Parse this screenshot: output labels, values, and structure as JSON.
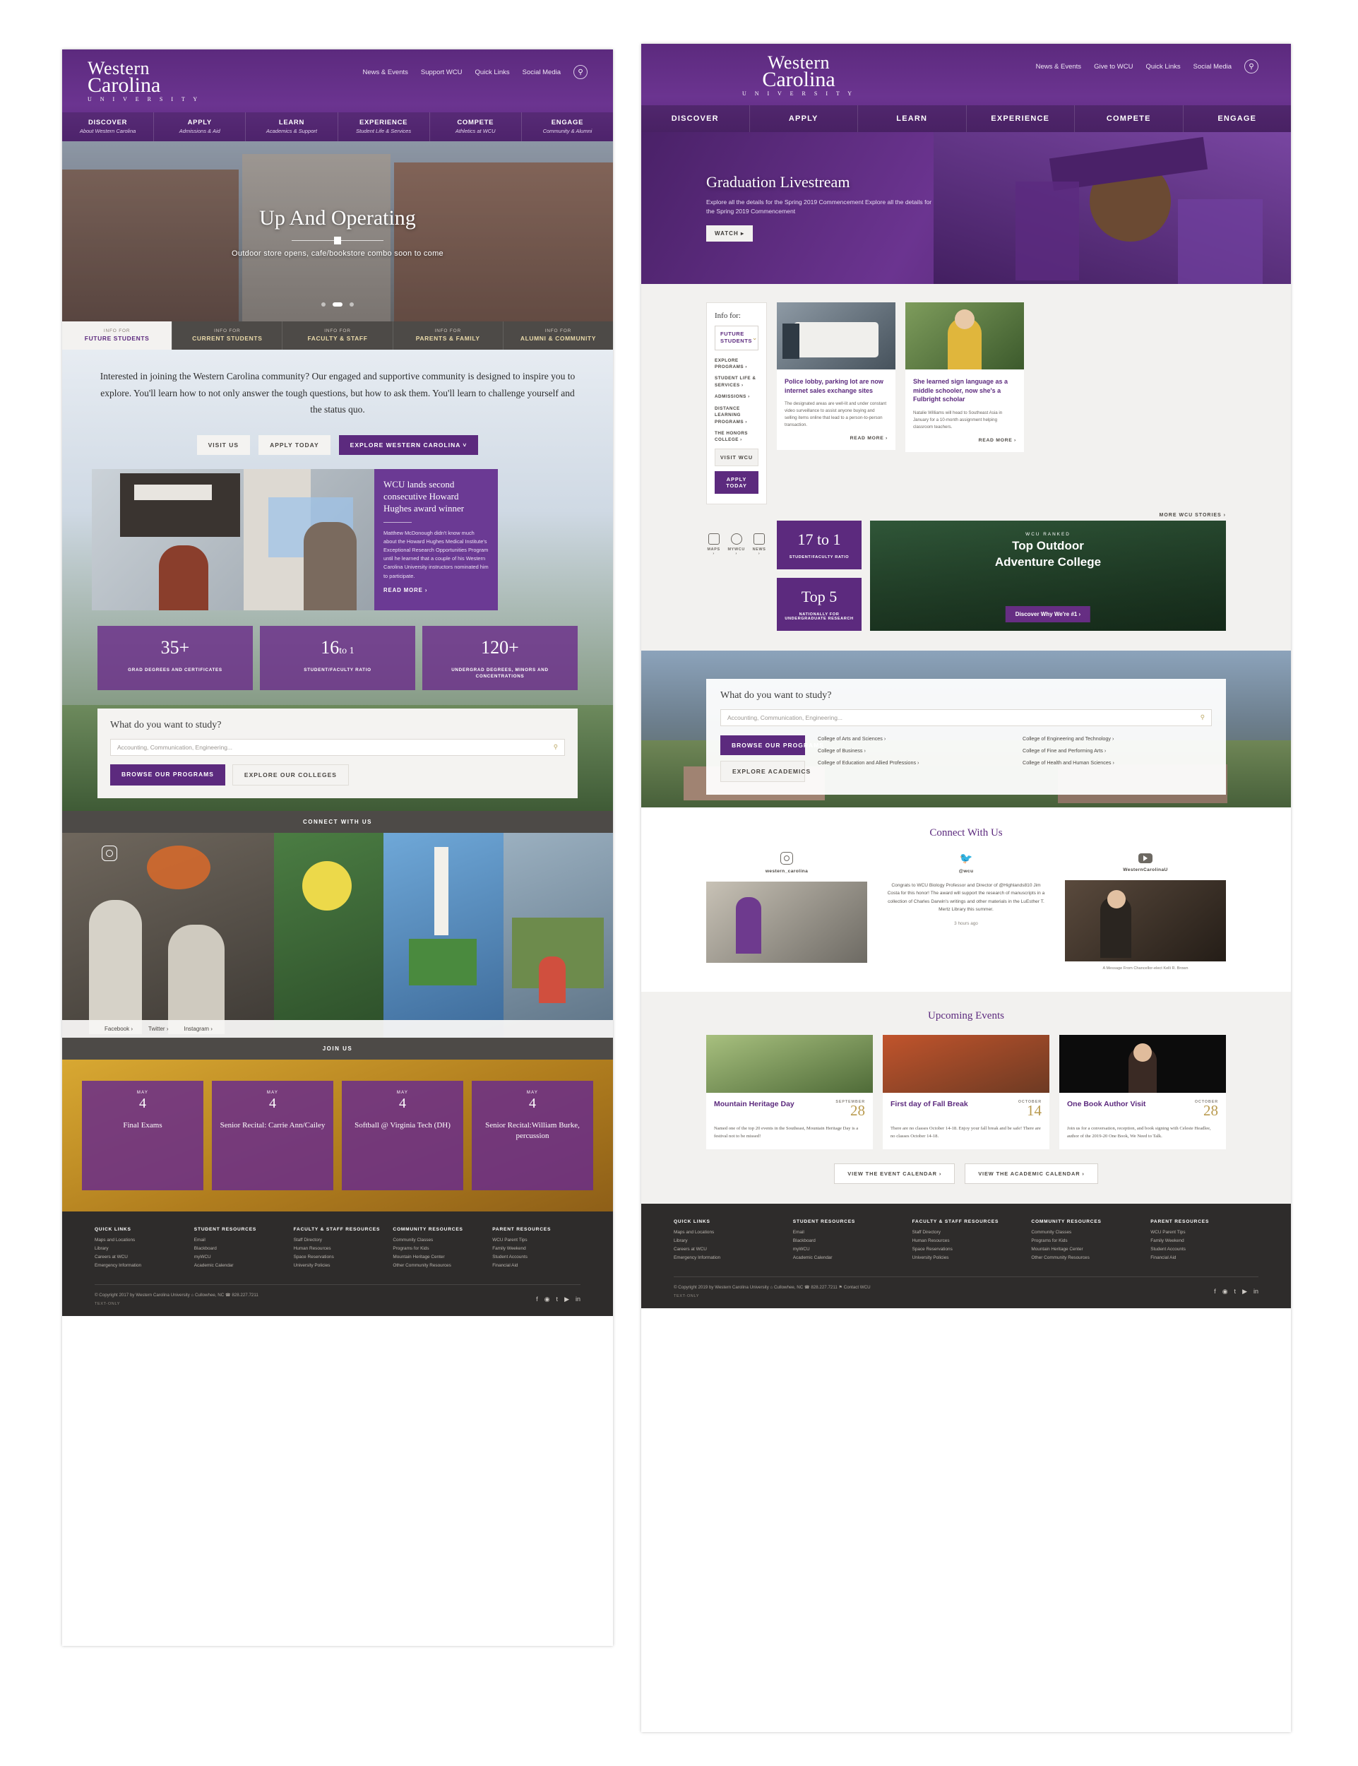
{
  "brand": {
    "line1": "Western",
    "line2": "Carolina",
    "line3": "U N I V E R S I T Y",
    "purple": "#5c2a7e",
    "gold": "#b99a4e",
    "dark": "#2e2c2b"
  },
  "top_links": [
    "News & Events",
    "Support WCU",
    "Quick Links",
    "Social Media"
  ],
  "top_links_b": [
    "News & Events",
    "Give to WCU",
    "Quick Links",
    "Social Media"
  ],
  "main_nav": [
    {
      "title": "DISCOVER",
      "sub": "About Western Carolina"
    },
    {
      "title": "APPLY",
      "sub": "Admissions & Aid"
    },
    {
      "title": "LEARN",
      "sub": "Academics & Support"
    },
    {
      "title": "EXPERIENCE",
      "sub": "Student Life & Services"
    },
    {
      "title": "COMPETE",
      "sub": "Athletics at WCU"
    },
    {
      "title": "ENGAGE",
      "sub": "Community & Alumni"
    }
  ],
  "main_nav_b": [
    "DISCOVER",
    "APPLY",
    "LEARN",
    "EXPERIENCE",
    "COMPETE",
    "ENGAGE"
  ],
  "heroA": {
    "title": "Up And Operating",
    "subtitle": "Outdoor store opens, cafe/bookstore combo soon to come"
  },
  "info_tabs": [
    {
      "kicker": "INFO FOR",
      "label": "FUTURE STUDENTS"
    },
    {
      "kicker": "INFO FOR",
      "label": "CURRENT STUDENTS"
    },
    {
      "kicker": "INFO FOR",
      "label": "FACULTY & STAFF"
    },
    {
      "kicker": "INFO FOR",
      "label": "PARENTS & FAMILY"
    },
    {
      "kicker": "INFO FOR",
      "label": "ALUMNI & COMMUNITY"
    }
  ],
  "intro": {
    "paragraph": "Interested in joining the Western Carolina community? Our engaged and supportive community is designed to inspire you to explore. You'll learn how to not only answer the tough questions, but how to ask them. You'll learn to challenge yourself and the status quo.",
    "buttons": [
      "VISIT US",
      "APPLY TODAY",
      "EXPLORE WESTERN CAROLINA  ˅"
    ]
  },
  "feature_card": {
    "title": "WCU lands second consecutive Howard Hughes award winner",
    "body": "Matthew McDonough didn't know much about the Howard Hughes Medical Institute's Exceptional Research Opportunities Program until he learned that a couple of his Western Carolina University instructors nominated him to participate.",
    "read_more": "READ MORE  ›"
  },
  "stats": [
    {
      "num": "35+",
      "sub": "",
      "label": "GRAD DEGREES AND CERTIFICATES"
    },
    {
      "num": "16",
      "sub": "to 1",
      "label": "STUDENT/FACULTY RATIO"
    },
    {
      "num": "120+",
      "sub": "",
      "label": "UNDERGRAD DEGREES, MINORS AND CONCENTRATIONS"
    }
  ],
  "study": {
    "heading": "What do you want to study?",
    "placeholder": "Accounting, Communication, Engineering...",
    "btn1": "BROWSE OUR PROGRAMS",
    "btn2": "EXPLORE OUR COLLEGES",
    "btn2b": "EXPLORE ACADEMICS"
  },
  "connect_strip": "CONNECT WITH US",
  "join_strip": "JOIN US",
  "social_row": [
    "Facebook  ›",
    "Twitter  ›",
    "Instagram  ›"
  ],
  "events_left": [
    {
      "month": "MAY",
      "day": "4",
      "title": "Final Exams"
    },
    {
      "month": "MAY",
      "day": "4",
      "title": "Senior Recital: Carrie Ann/Cailey"
    },
    {
      "month": "MAY",
      "day": "4",
      "title": "Softball @ Virginia Tech (DH)"
    },
    {
      "month": "MAY",
      "day": "4",
      "title": "Senior Recital:William Burke, percussion"
    }
  ],
  "footer": {
    "columns": [
      {
        "head": "QUICK LINKS",
        "links": [
          "Maps and Locations",
          "Library",
          "Careers at WCU",
          "Emergency Information"
        ]
      },
      {
        "head": "STUDENT RESOURCES",
        "links": [
          "Email",
          "Blackboard",
          "myWCU",
          "Academic Calendar"
        ]
      },
      {
        "head": "FACULTY & STAFF RESOURCES",
        "links": [
          "Staff Directory",
          "Human Resources",
          "Space Reservations",
          "University Policies"
        ]
      },
      {
        "head": "COMMUNITY RESOURCES",
        "links": [
          "Community Classes",
          "Programs for Kids",
          "Mountain Heritage Center",
          "Other Community Resources"
        ]
      },
      {
        "head": "PARENT RESOURCES",
        "links": [
          "WCU Parent Tips",
          "Family Weekend",
          "Student Accounts",
          "Financial Aid"
        ]
      }
    ],
    "copyright_a": "© Copyright 2017 by Western Carolina University   ⌂ Cullowhee, NC   ☎ 828.227.7211",
    "copyright_b": "© Copyright 2019 by Western Carolina University   ⌂ Cullowhee, NC   ☎ 828.227.7211   ⚑ Contact WCU",
    "text_only": "TEXT-ONLY",
    "social_icons_a": [
      "f",
      "◉",
      "t",
      "▶",
      "in"
    ],
    "social_icons_b": [
      "f",
      "◉",
      "t",
      "▶",
      "in"
    ]
  },
  "heroB": {
    "title": "Graduation Livestream",
    "body": "Explore all the details for the Spring 2019 Commencement Explore all the details for the Spring 2019 Commencement",
    "button": "WATCH  ▸"
  },
  "info_for": {
    "heading": "Info for:",
    "selected": "FUTURE STUDENTS",
    "links": [
      "EXPLORE PROGRAMS ›",
      "STUDENT LIFE & SERVICES ›",
      "ADMISSIONS ›",
      "DISTANCE LEARNING PROGRAMS ›",
      "THE HONORS COLLEGE ›"
    ],
    "visit": "VISIT WCU",
    "apply": "APPLY TODAY"
  },
  "news_cards": [
    {
      "title": "Police lobby, parking lot are now internet sales exchange sites",
      "body": "The designated areas are well-lit and under constant video surveillance to assist anyone buying and selling items online that lead to a person-to-person transaction.",
      "read_more": "READ MORE ›"
    },
    {
      "title": "She learned sign language as a middle schooler, now she's a Fulbright scholar",
      "body": "Natalie Williams will head to Southeast Asia in January for a 10-month assignment helping classroom teachers.",
      "read_more": "READ MORE ›"
    }
  ],
  "more_stories": "MORE WCU STORIES ›",
  "quick_icons": [
    {
      "label": "MAPS ›",
      "icon": "map-icon"
    },
    {
      "label": "MYWCU ›",
      "icon": "user-icon"
    },
    {
      "label": "NEWS ›",
      "icon": "news-icon"
    }
  ],
  "stats_b": [
    {
      "num": "17 to 1",
      "label": "STUDENT/FACULTY RATIO"
    },
    {
      "num": "Top 5",
      "label": "NATIONALLY FOR UNDERGRADUATE RESEARCH"
    }
  ],
  "adventure": {
    "kicker": "WCU RANKED",
    "line1": "Top Outdoor",
    "line2": "Adventure College",
    "pill": "Discover Why We're #1  ›"
  },
  "colleges": [
    "College of Arts and Sciences ›",
    "College of Business ›",
    "College of Education and Allied Professions ›",
    "College of Engineering and Technology ›",
    "College of Fine and Performing Arts ›",
    "College of Health and Human Sciences ›"
  ],
  "connect_b": {
    "heading": "Connect With Us",
    "instagram": {
      "handle": "western_carolina",
      "icon": "instagram-icon"
    },
    "twitter": {
      "handle": "@wcu",
      "icon": "twitter-icon",
      "text": "Congrats to WCU Biology Professor and Director of @Highlands810 Jim Costa for this honor! The award will support the research of manuscripts in a collection of Charles Darwin's writings and other materials in the LuEsther T. Mertz Library this summer.",
      "time": "3 hours ago"
    },
    "youtube": {
      "handle": "WesternCarolinaU",
      "icon": "youtube-icon",
      "caption": "A Message From Chancellor-elect Kelli R. Brown"
    }
  },
  "events_b": {
    "heading": "Upcoming Events",
    "cards": [
      {
        "title": "Mountain Heritage Day",
        "month": "SEPTEMBER",
        "day": "28",
        "desc": "Named one of the top 20 events in the Southeast, Mountain Heritage Day is a festival not to be missed!"
      },
      {
        "title": "First day of Fall Break",
        "month": "OCTOBER",
        "day": "14",
        "desc": "There are no classes October 14-18. Enjoy your fall break and be safe! There are no classes October 14-18."
      },
      {
        "title": "One Book Author Visit",
        "month": "OCTOBER",
        "day": "28",
        "desc": "Join us for a conversation, reception, and book signing with Celeste Headlee, author of the 2019-20 One Book, We Need to Talk."
      }
    ],
    "btn1": "VIEW THE EVENT CALENDAR ›",
    "btn2": "VIEW THE ACADEMIC CALENDAR ›"
  }
}
